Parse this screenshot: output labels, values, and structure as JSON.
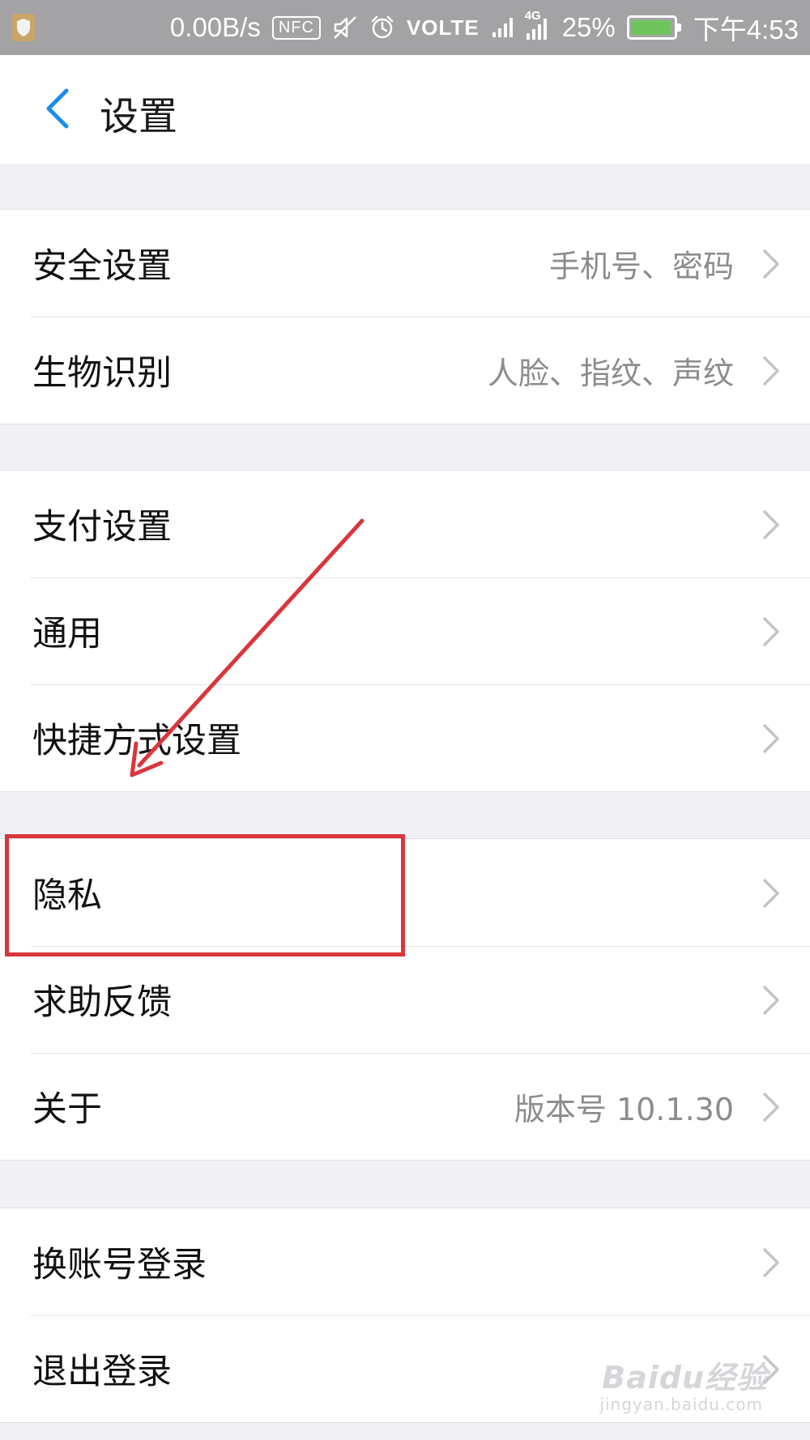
{
  "status_bar": {
    "speed": "0.00B/s",
    "nfc": "NFC",
    "volte": "VOLTE",
    "network": "4G",
    "battery_percent": "25%",
    "battery_level": 0.25,
    "time": "下午4:53",
    "icons": [
      "app-shield-icon",
      "mute-icon",
      "alarm-icon",
      "signal-icon",
      "signal-4g-icon",
      "battery-icon"
    ]
  },
  "header": {
    "back_icon": "back-chevron-icon",
    "title": "设置"
  },
  "groups": [
    {
      "items": [
        {
          "label": "安全设置",
          "value": "手机号、密码"
        },
        {
          "label": "生物识别",
          "value": "人脸、指纹、声纹"
        }
      ]
    },
    {
      "items": [
        {
          "label": "支付设置",
          "value": ""
        },
        {
          "label": "通用",
          "value": ""
        },
        {
          "label": "快捷方式设置",
          "value": ""
        }
      ]
    },
    {
      "items": [
        {
          "label": "隐私",
          "value": ""
        },
        {
          "label": "求助反馈",
          "value": ""
        },
        {
          "label": "关于",
          "value": "版本号 10.1.30"
        }
      ]
    },
    {
      "items": [
        {
          "label": "换账号登录",
          "value": ""
        },
        {
          "label": "退出登录",
          "value": ""
        }
      ]
    }
  ],
  "colors": {
    "accent_blue": "#1a8cf0",
    "annotation_red": "#d9363b",
    "status_bar": "#a3a3a6",
    "background": "#f1f1f5"
  },
  "watermark": {
    "main": "Baidu经验",
    "sub": "jingyan.baidu.com"
  }
}
